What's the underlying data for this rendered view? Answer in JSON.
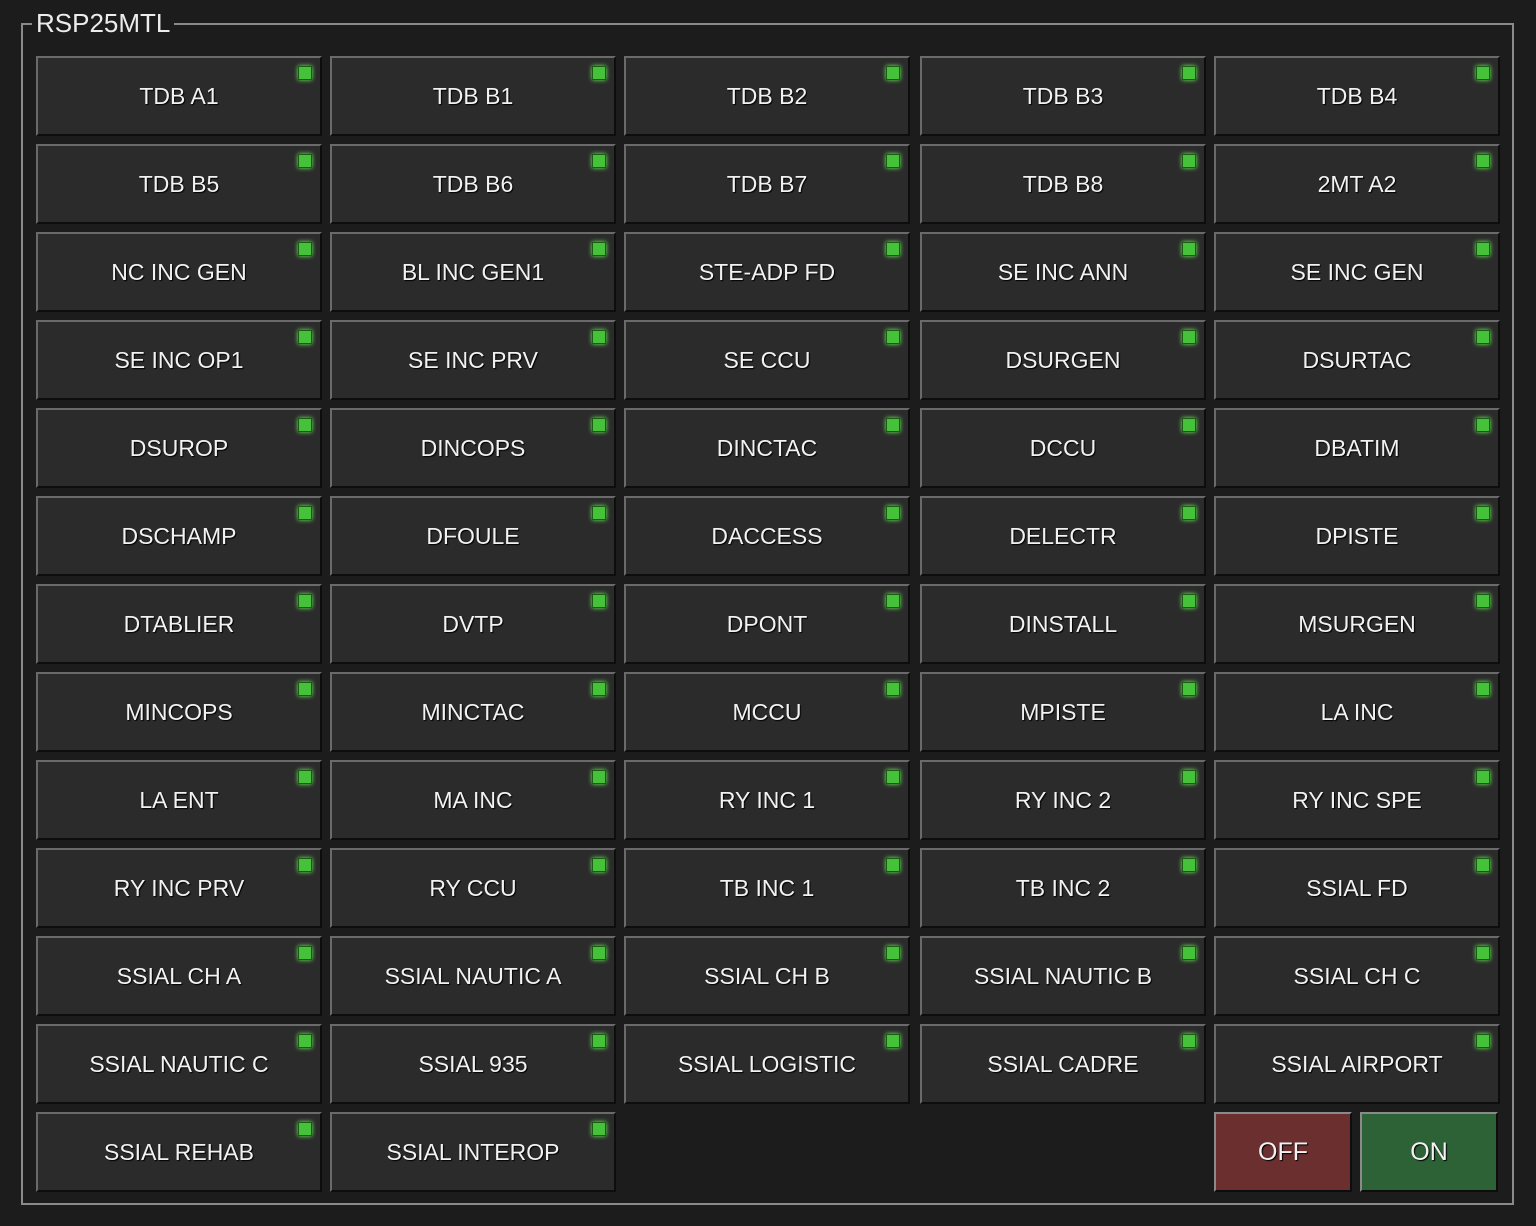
{
  "group": {
    "title": "RSP25MTL"
  },
  "colors": {
    "led": "#45c23a",
    "off": "#6b2f2f",
    "on": "#2d6236",
    "button": "#2b2b2b"
  },
  "buttons": [
    "TDB A1",
    "TDB B1",
    "TDB B2",
    "TDB B3",
    "TDB B4",
    "TDB B5",
    "TDB B6",
    "TDB B7",
    "TDB B8",
    "2MT A2",
    "NC INC GEN",
    "BL INC GEN1",
    "STE-ADP FD",
    "SE INC ANN",
    "SE INC GEN",
    "SE INC OP1",
    "SE INC PRV",
    "SE CCU",
    "DSURGEN",
    "DSURTAC",
    "DSUROP",
    "DINCOPS",
    "DINCTAC",
    "DCCU",
    "DBATIM",
    "DSCHAMP",
    "DFOULE",
    "DACCESS",
    "DELECTR",
    "DPISTE",
    "DTABLIER",
    "DVTP",
    "DPONT",
    "DINSTALL",
    "MSURGEN",
    "MINCOPS",
    "MINCTAC",
    "MCCU",
    "MPISTE",
    "LA INC",
    "LA ENT",
    "MA INC",
    "RY INC 1",
    "RY INC 2",
    "RY INC SPE",
    "RY INC PRV",
    "RY CCU",
    "TB INC 1",
    "TB INC 2",
    "SSIAL FD",
    "SSIAL CH A",
    "SSIAL NAUTIC A",
    "SSIAL CH B",
    "SSIAL NAUTIC B",
    "SSIAL CH C",
    "SSIAL NAUTIC C",
    "SSIAL 935",
    "SSIAL LOGISTIC",
    "SSIAL CADRE",
    "SSIAL AIRPORT",
    "SSIAL REHAB",
    "SSIAL INTEROP"
  ],
  "controls": {
    "off_label": "OFF",
    "on_label": "ON"
  }
}
